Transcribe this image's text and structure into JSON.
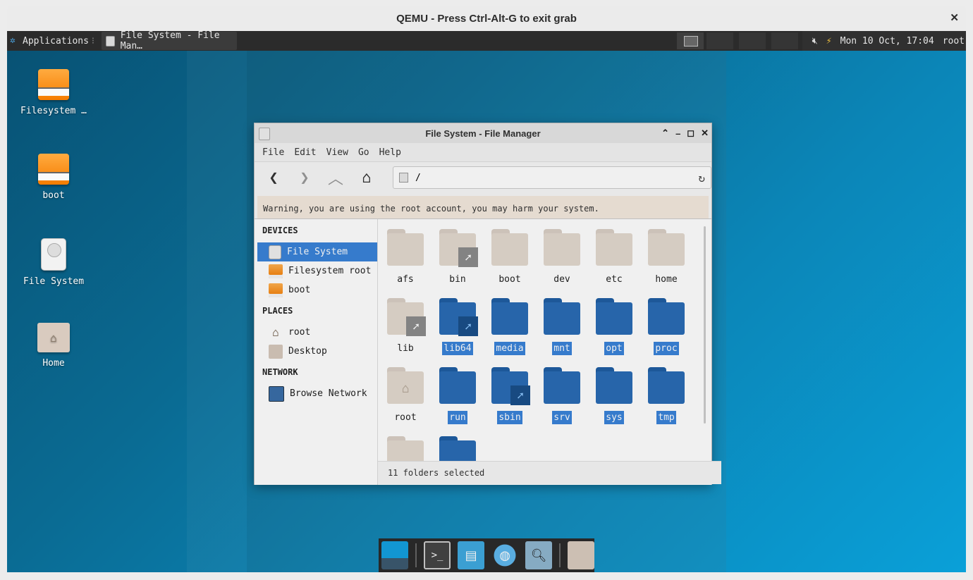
{
  "qemu": {
    "title": "QEMU - Press Ctrl-Alt-G to exit grab",
    "close": "✕"
  },
  "panel": {
    "applications": "Applications",
    "task_title": "File System - File Man…",
    "datetime": "Mon 10 Oct, 17:04",
    "user": "root"
  },
  "desktop_icons": [
    {
      "label": "Filesystem …"
    },
    {
      "label": "boot"
    },
    {
      "label": "File System"
    },
    {
      "label": "Home"
    }
  ],
  "fm": {
    "title": "File System - File Manager",
    "menu": [
      "File",
      "Edit",
      "View",
      "Go",
      "Help"
    ],
    "path": "/",
    "warning": "Warning, you are using the root account, you may harm your system.",
    "sidebar": {
      "devices_head": "DEVICES",
      "devices": [
        "File System",
        "Filesystem root",
        "boot"
      ],
      "places_head": "PLACES",
      "places": [
        "root",
        "Desktop"
      ],
      "network_head": "NETWORK",
      "network": [
        "Browse Network"
      ]
    },
    "folders": [
      "afs",
      "bin",
      "boot",
      "dev",
      "etc",
      "home",
      "lib",
      "lib64",
      "media",
      "mnt",
      "opt",
      "proc",
      "root",
      "run",
      "sbin",
      "srv",
      "sys",
      "tmp"
    ],
    "status": "11 folders selected"
  },
  "colors": {
    "selection": "#3a83d9",
    "panel": "#2b2b2b",
    "folder_blue": "#2a6cb5",
    "folder_beige": "#e3d9cf"
  }
}
